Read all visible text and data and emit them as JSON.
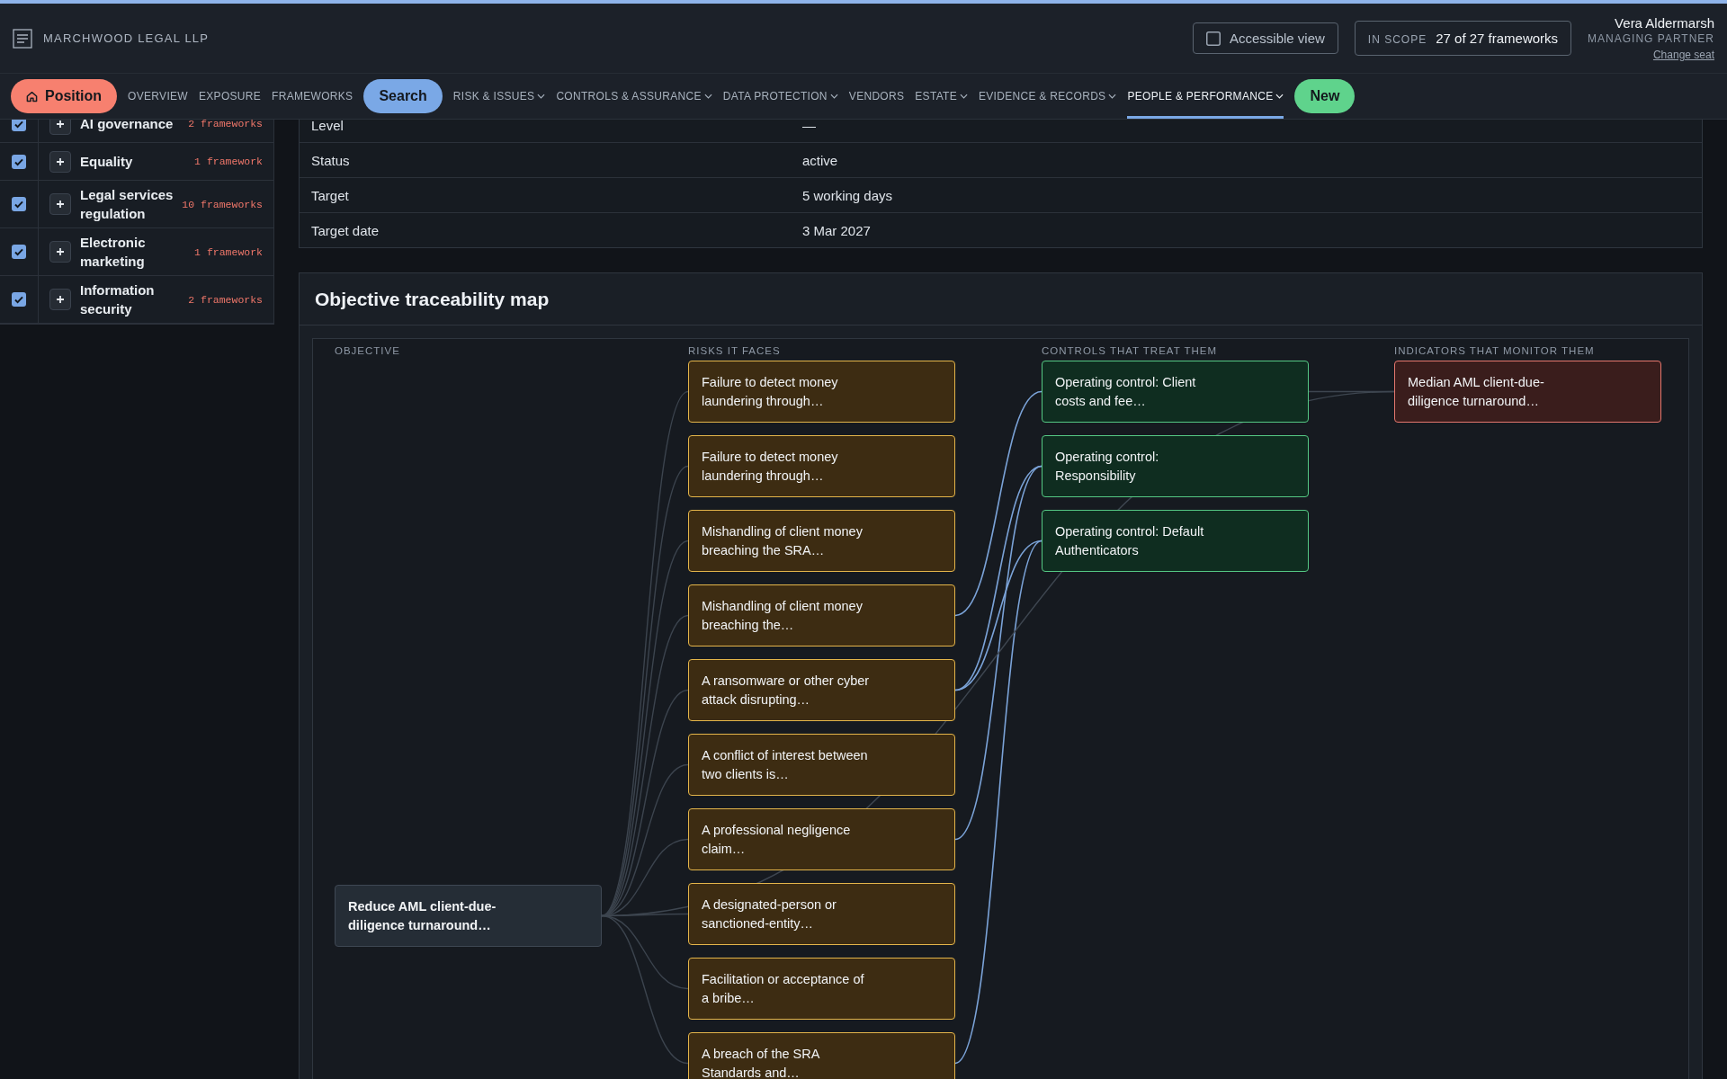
{
  "header": {
    "brand": "MARCHWOOD LEGAL LLP",
    "accessible_view": {
      "label": "Accessible view",
      "checked": false
    },
    "scope": {
      "label": "IN SCOPE",
      "value": "27 of 27 frameworks"
    },
    "user": {
      "name": "Vera Aldermarsh",
      "role": "MANAGING PARTNER",
      "link": "Change seat"
    }
  },
  "nav": [
    {
      "kind": "home",
      "label": "Position",
      "color": "#f7806f",
      "selected": false
    },
    {
      "kind": "link",
      "label": "OVERVIEW",
      "dropdown": false,
      "selected": false
    },
    {
      "kind": "link",
      "label": "EXPOSURE",
      "dropdown": false,
      "selected": false
    },
    {
      "kind": "link",
      "label": "FRAMEWORKS",
      "dropdown": false,
      "selected": false
    },
    {
      "kind": "pill",
      "label": "Search",
      "color": "#7aa8e6",
      "selected": false
    },
    {
      "kind": "link",
      "label": "RISK & ISSUES",
      "dropdown": true,
      "selected": false
    },
    {
      "kind": "link",
      "label": "CONTROLS & ASSURANCE",
      "dropdown": true,
      "selected": false
    },
    {
      "kind": "link",
      "label": "DATA PROTECTION",
      "dropdown": true,
      "selected": false
    },
    {
      "kind": "link",
      "label": "VENDORS",
      "dropdown": false,
      "selected": false
    },
    {
      "kind": "link",
      "label": "ESTATE",
      "dropdown": true,
      "selected": false
    },
    {
      "kind": "link",
      "label": "EVIDENCE & RECORDS",
      "dropdown": true,
      "selected": false
    },
    {
      "kind": "link",
      "label": "PEOPLE & PERFORMANCE",
      "dropdown": true,
      "selected": true
    },
    {
      "kind": "pill",
      "label": "New",
      "color": "#5fd38c",
      "selected": false
    }
  ],
  "sidebar": {
    "items": [
      {
        "label": "AI governance",
        "count": "2 frameworks",
        "checked": true
      },
      {
        "label": "Equality",
        "count": "1 framework",
        "checked": true
      },
      {
        "label": "Legal services regulation",
        "count": "10 frameworks",
        "checked": true
      },
      {
        "label": "Electronic marketing",
        "count": "1 framework",
        "checked": true
      },
      {
        "label": "Information security",
        "count": "2 frameworks",
        "checked": true
      }
    ]
  },
  "details": {
    "rows": [
      {
        "label": "Level",
        "value": "—"
      },
      {
        "label": "Status",
        "value": "active"
      },
      {
        "label": "Target",
        "value": "5 working days"
      },
      {
        "label": "Target date",
        "value": "3 Mar 2027"
      }
    ]
  },
  "traceability_map": {
    "title": "Objective traceability map",
    "columns": [
      "OBJECTIVE",
      "RISKS IT FACES",
      "CONTROLS THAT TREAT THEM",
      "INDICATORS THAT MONITOR THEM"
    ],
    "objective": {
      "text": "Reduce AML client-due-diligence turnaround…"
    },
    "risks": [
      {
        "text": "Failure to detect money laundering through…"
      },
      {
        "text": "Failure to detect money laundering through…"
      },
      {
        "text": "Mishandling of client money breaching the SRA…"
      },
      {
        "text": "Mishandling of client money breaching the…"
      },
      {
        "text": "A ransomware or other cyber attack disrupting…"
      },
      {
        "text": "A conflict of interest between two clients is…"
      },
      {
        "text": "A professional negligence claim…"
      },
      {
        "text": "A designated-person or sanctioned-entity…"
      },
      {
        "text": "Facilitation or acceptance of a bribe…"
      },
      {
        "text": "A breach of the SRA Standards and…"
      }
    ],
    "controls": [
      {
        "text": "Operating control: Client costs and fee…"
      },
      {
        "text": "Operating control: Responsibility"
      },
      {
        "text": "Operating control: Default Authenticators"
      }
    ],
    "indicators": [
      {
        "text": "Median AML client-due-diligence turnaround…"
      }
    ]
  }
}
